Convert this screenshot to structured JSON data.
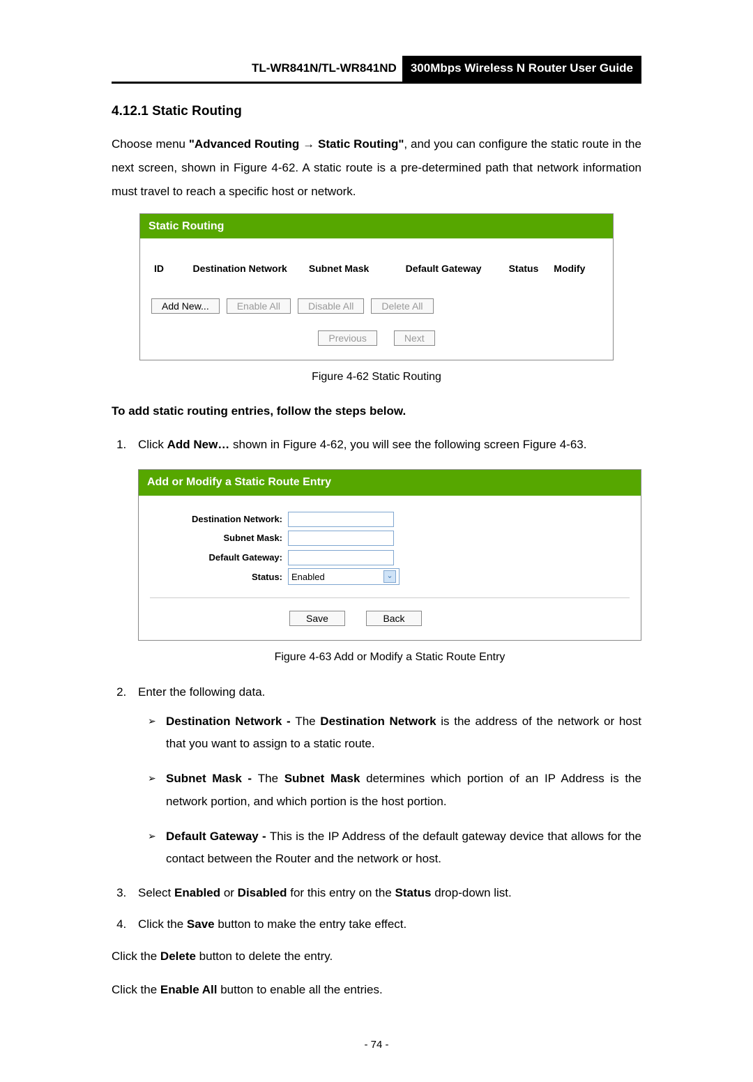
{
  "header": {
    "model": "TL-WR841N/TL-WR841ND",
    "title": "300Mbps Wireless N Router User Guide"
  },
  "section": {
    "number": "4.12.1",
    "title": "Static Routing"
  },
  "intro": {
    "p1a": "Choose menu ",
    "p1b": "\"Advanced Routing",
    "arrow": "→",
    "p1c": "Static Routing\"",
    "p1d": ", and you can configure the static route in the next screen, shown in Figure 4-62. A static route is a pre-determined path that network information must travel to reach a specific host or network."
  },
  "shot1": {
    "title": "Static Routing",
    "columns": {
      "id": "ID",
      "dest": "Destination Network",
      "mask": "Subnet Mask",
      "gw": "Default Gateway",
      "status": "Status",
      "modify": "Modify"
    },
    "buttons": {
      "add": "Add New...",
      "enable_all": "Enable All",
      "disable_all": "Disable All",
      "delete_all": "Delete All",
      "previous": "Previous",
      "next": "Next"
    },
    "caption": "Figure 4-62    Static Routing"
  },
  "addSteps": {
    "heading": "To add static routing entries, follow the steps below.",
    "s1a": "Click ",
    "s1b": "Add New…",
    "s1c": " shown in Figure 4-62, you will see the following screen Figure 4-63."
  },
  "shot2": {
    "title": "Add or Modify a Static Route Entry",
    "labels": {
      "dest": "Destination Network:",
      "mask": "Subnet Mask:",
      "gw": "Default Gateway:",
      "status": "Status:"
    },
    "status_value": "Enabled",
    "buttons": {
      "save": "Save",
      "back": "Back"
    },
    "caption": "Figure 4-63    Add or Modify a Static Route Entry"
  },
  "step2": {
    "lead": "Enter the following data.",
    "items": [
      {
        "t1": "Destination Network - ",
        "t2": "The ",
        "t3": "Destination Network",
        "t4": " is the address of the network or host that you want to assign to a static route."
      },
      {
        "t1": "Subnet Mask - ",
        "t2": "The ",
        "t3": "Subnet Mask",
        "t4": " determines which portion of an IP Address is the network portion, and which portion is the host portion."
      },
      {
        "t1": "Default Gateway - ",
        "t2": "",
        "t3": "",
        "t4": "This is the IP Address of the default gateway device that allows for the contact between the Router and the network or host."
      }
    ]
  },
  "step3": {
    "a": "Select ",
    "b": "Enabled",
    "c": " or ",
    "d": "Disabled",
    "e": " for this entry on the ",
    "f": "Status",
    "g": " drop-down list."
  },
  "step4": {
    "a": "Click the ",
    "b": "Save",
    "c": " button to make the entry take effect."
  },
  "tail1": {
    "a": "Click the ",
    "b": "Delete",
    "c": " button to delete the entry."
  },
  "tail2": {
    "a": "Click the ",
    "b": "Enable All",
    "c": " button to enable all the entries."
  },
  "page_number": "- 74 -"
}
